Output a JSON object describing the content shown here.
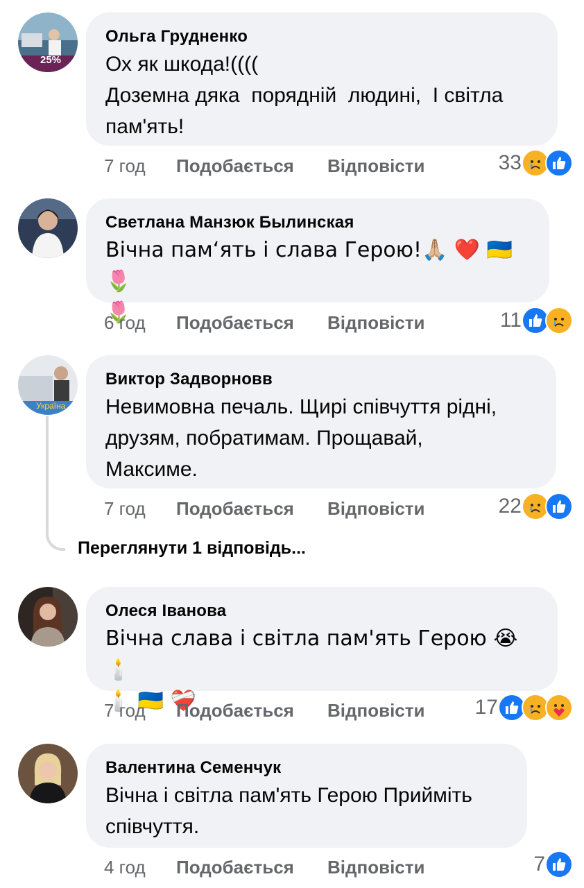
{
  "comments": [
    {
      "author": "Ольга Грудненко",
      "text": "Ох як шкода!((((\nДоземна дяка  порядній  людині,  І світла пам'ять!",
      "time": "7 год",
      "like_label": "Подобається",
      "reply_label": "Відповісти",
      "reaction_count": "33",
      "avatar_badge": "25%"
    },
    {
      "author": "Светлана Манзюк Былинская",
      "text": "Вічна пам‘ять і слава Герою!🙏🏼 ❤️ 🇺🇦 🌷\n🌷",
      "time": "6 год",
      "like_label": "Подобається",
      "reply_label": "Відповісти",
      "reaction_count": "11"
    },
    {
      "author": "Виктор Задворновв",
      "text": "Невимовна печаль. Щирі співчуття рідні,\nдрузям, побратимам. Прощавай,\nМаксиме.",
      "time": "7 год",
      "like_label": "Подобається",
      "reply_label": "Відповісти",
      "reaction_count": "22",
      "avatar_badge": "Україна"
    },
    {
      "author": "Олеся Іванова",
      "text": "Вічна слава і світла пам'ять Герою 😭 🕯️\n🕯️ 🇺🇦 ❤️‍🩹",
      "time": "7 год",
      "like_label": "Подобається",
      "reply_label": "Відповісти",
      "reaction_count": "17"
    },
    {
      "author": "Валентина Семенчук",
      "text": "Вічна і світла пам'ять Герою Прийміть\nспівчуття.",
      "time": "4 год",
      "like_label": "Подобається",
      "reply_label": "Відповісти",
      "reaction_count": "7"
    }
  ],
  "view_replies": "Переглянути 1 відповідь...",
  "colors": {
    "bubble": "#f0f2f5",
    "meta": "#65676b",
    "like": "#1877f2",
    "sad": "#f7b125"
  },
  "icons": [
    "sad-reaction-icon",
    "like-reaction-icon",
    "care-reaction-icon"
  ]
}
